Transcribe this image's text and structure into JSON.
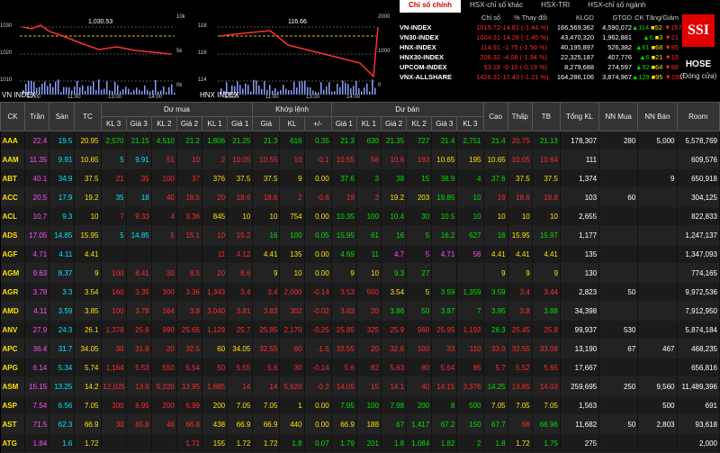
{
  "chart1": {
    "title": "VN INDEX",
    "value": "1,030.53",
    "y_left": [
      "1030",
      "1020",
      "1010"
    ],
    "y_right": [
      "10k",
      "5k",
      "0k"
    ],
    "x": [
      "10:00",
      "11:00",
      "13:00",
      "14:00"
    ]
  },
  "chart2": {
    "title": "HNX INDEX",
    "value": "116.66",
    "y_left": [
      "118",
      "116",
      "114"
    ],
    "y_right": [
      "2000",
      "1000",
      "0"
    ],
    "x": [
      "10:00",
      "11:00",
      "13:00",
      "14:00"
    ]
  },
  "tabs": [
    "Chỉ số chính",
    "HSX-chỉ số khác",
    "HSX-TRI",
    "HSX-chỉ số ngành"
  ],
  "index_headers": [
    "",
    "Chỉ số",
    "% Thay đổi",
    "KLGD",
    "GTGD",
    "CK Tăng/Giảm"
  ],
  "indexes": [
    {
      "name": "VN-INDEX",
      "value": "1015.72",
      "change": "-14.81 (-1.44 %)",
      "klgd": "166,569,362",
      "gtgd": "4,590,072",
      "up": "114",
      "flat": "52",
      "down": "157"
    },
    {
      "name": "VN30-INDEX",
      "value": "1004.31",
      "change": "-14.28 (-1.40 %)",
      "klgd": "43,470,320",
      "gtgd": "1,962,881",
      "up": "6",
      "flat": "3",
      "down": "21"
    },
    {
      "name": "HNX-INDEX",
      "value": "114.91",
      "change": "-1.75 (-1.50 %)",
      "klgd": "40,195,897",
      "gtgd": "526,382",
      "up": "61",
      "flat": "68",
      "down": "85"
    },
    {
      "name": "HNX30-INDEX",
      "value": "206.32",
      "change": "-4.08 (-1.94 %)",
      "klgd": "22,325,187",
      "gtgd": "407,776",
      "up": "6",
      "flat": "21",
      "down": "15"
    },
    {
      "name": "UPCOM-INDEX",
      "value": "53.18",
      "change": "-0.10 (-0.19 %)",
      "klgd": "8,279,688",
      "gtgd": "274,597",
      "up": "92",
      "flat": "64",
      "down": "88"
    },
    {
      "name": "VNX-ALLSHARE",
      "value": "1426.31",
      "change": "-17.43 (-1.21 %)",
      "klgd": "164,286,106",
      "gtgd": "3,874,967",
      "up": "129",
      "flat": "95",
      "down": "195"
    }
  ],
  "logo": "SSI",
  "exchange": "HOSE",
  "exchange_status": "(Đóng cửa)",
  "table": {
    "group_headers": [
      "CK",
      "Trần",
      "Sàn",
      "TC",
      "Dư mua",
      "Khớp lệnh",
      "Dư bán",
      "Cao",
      "Thấp",
      "TB",
      "Tổng KL",
      "NN Mua",
      "NN Bán",
      "Room"
    ],
    "sub_headers": [
      "KL 3",
      "Giá 3",
      "KL 2",
      "Giá 2",
      "KL 1",
      "Giá 1",
      "Giá",
      "KL",
      "+/-",
      "Giá 1",
      "KL 1",
      "Giá 2",
      "KL 2",
      "Giá 3",
      "KL 3"
    ],
    "rows": [
      [
        "AAA",
        "22.4",
        "19.5",
        "20.95",
        "2,570",
        "21.15",
        "4,510",
        "21.2",
        "1,806",
        "21.25",
        "21.3",
        "616",
        "0.35",
        "21.3",
        "630",
        "21.35",
        "727",
        "21.4",
        "2,751",
        "21.4",
        "20.75",
        "21.13",
        "178,307",
        "280",
        "5,000",
        "5,578,769"
      ],
      [
        "AAM",
        "11.35",
        "9.91",
        "10.65",
        "5",
        "9.91",
        "51",
        "10",
        "2",
        "10.05",
        "10.55",
        "10",
        "-0.1",
        "10.55",
        "56",
        "10.6",
        "193",
        "10.65",
        "195",
        "10.65",
        "10.05",
        "10.64",
        "111",
        "",
        "",
        "609,576"
      ],
      [
        "ABT",
        "40.1",
        "34.9",
        "37.5",
        "21",
        "35",
        "100",
        "37",
        "376",
        "37.5",
        "37.5",
        "9",
        "0.00",
        "37.6",
        "3",
        "38",
        "15",
        "38.9",
        "4",
        "37.6",
        "37.5",
        "37.5",
        "1,374",
        "",
        "9",
        "650,918"
      ],
      [
        "ACC",
        "20.5",
        "17.9",
        "19.2",
        "35",
        "18",
        "40",
        "18.5",
        "20",
        "18.6",
        "18.6",
        "2",
        "-0.6",
        "19",
        "3",
        "19.2",
        "203",
        "19.85",
        "10",
        "19",
        "18.6",
        "18.8",
        "103",
        "60",
        "",
        "304,125"
      ],
      [
        "ACL",
        "10.7",
        "9.3",
        "10",
        "7",
        "9.33",
        "4",
        "9.36",
        "845",
        "10",
        "10",
        "754",
        "0.00",
        "10.35",
        "100",
        "10.4",
        "30",
        "10.5",
        "10",
        "10",
        "10",
        "10",
        "2,655",
        "",
        "",
        "822,833"
      ],
      [
        "ADS",
        "17.05",
        "14.85",
        "15.95",
        "5",
        "14.85",
        "5",
        "15.1",
        "10",
        "15.2",
        "16",
        "100",
        "0.05",
        "15.95",
        "61",
        "16",
        "5",
        "16.2",
        "627",
        "16",
        "15.95",
        "15.97",
        "1,177",
        "",
        "",
        "1,247,137"
      ],
      [
        "AGF",
        "4.71",
        "4.11",
        "4.41",
        "",
        "",
        "",
        "",
        "11",
        "4.12",
        "4.41",
        "135",
        "0.00",
        "4.69",
        "11",
        "4.7",
        "5",
        "4.71",
        "56",
        "4.41",
        "4.41",
        "4.41",
        "135",
        "",
        "",
        "1,347,093"
      ],
      [
        "AGM",
        "9.63",
        "8.37",
        "9",
        "100",
        "8.41",
        "30",
        "8.5",
        "20",
        "8.6",
        "9",
        "10",
        "0.00",
        "9",
        "10",
        "9.3",
        "27",
        "",
        "",
        "9",
        "9",
        "9",
        "130",
        "",
        "",
        "774,165"
      ],
      [
        "AGR",
        "3.78",
        "3.3",
        "3.54",
        "160",
        "3.35",
        "300",
        "3.36",
        "1,343",
        "3.4",
        "3.4",
        "2,000",
        "-0.14",
        "3.53",
        "500",
        "3.54",
        "5",
        "3.59",
        "1,359",
        "3.59",
        "3.4",
        "3.44",
        "2,823",
        "50",
        "",
        "9,972,536"
      ],
      [
        "AMD",
        "4.11",
        "3.59",
        "3.85",
        "100",
        "3.78",
        "164",
        "3.8",
        "3,040",
        "3.81",
        "3.83",
        "302",
        "-0.02",
        "3.83",
        "20",
        "3.86",
        "50",
        "3.87",
        "7",
        "3.95",
        "3.8",
        "3.88",
        "34,398",
        "",
        "",
        "7,912,950"
      ],
      [
        "ANV",
        "27.9",
        "24.3",
        "26.1",
        "1,378",
        "25.6",
        "990",
        "25.65",
        "1,129",
        "25.7",
        "25.85",
        "2,170",
        "-0.25",
        "25.85",
        "325",
        "25.9",
        "960",
        "25.95",
        "1,192",
        "26.3",
        "25.45",
        "25.8",
        "99,937",
        "530",
        "",
        "5,874,184"
      ],
      [
        "APC",
        "36.4",
        "31.7",
        "34.05",
        "30",
        "31.9",
        "20",
        "32.5",
        "60",
        "34.05",
        "32.55",
        "60",
        "-1.5",
        "32.55",
        "20",
        "32.6",
        "100",
        "33",
        "110",
        "33.9",
        "32.55",
        "33.09",
        "13,190",
        "67",
        "467",
        "468,235"
      ],
      [
        "APG",
        "6.14",
        "5.34",
        "5.74",
        "1,164",
        "5.53",
        "550",
        "5.54",
        "50",
        "5.55",
        "5.6",
        "30",
        "-0.14",
        "5.6",
        "82",
        "5.63",
        "80",
        "5.64",
        "85",
        "5.7",
        "5.52",
        "5.65",
        "17,667",
        "",
        "",
        "656,816"
      ],
      [
        "ASM",
        "15.15",
        "13.25",
        "14.2",
        "12,025",
        "13.9",
        "5,220",
        "13.95",
        "1,885",
        "14",
        "14",
        "5,620",
        "-0.2",
        "14.05",
        "15",
        "14.1",
        "40",
        "14.15",
        "3,376",
        "14.25",
        "13.85",
        "14.03",
        "259,695",
        "250",
        "9,560",
        "11,489,396"
      ],
      [
        "ASP",
        "7.54",
        "6.56",
        "7.05",
        "300",
        "6.95",
        "200",
        "6.99",
        "200",
        "7.05",
        "7.05",
        "1",
        "0.00",
        "7.95",
        "100",
        "7.98",
        "200",
        "8",
        "500",
        "7.05",
        "7.05",
        "7.05",
        "1,563",
        "",
        "500",
        "691"
      ],
      [
        "AST",
        "71.5",
        "62.3",
        "66.9",
        "30",
        "65.8",
        "46",
        "66.8",
        "438",
        "66.9",
        "66.9",
        "440",
        "0.00",
        "66.9",
        "188",
        "67",
        "1,417",
        "67.2",
        "150",
        "67.7",
        "66",
        "66.96",
        "11,682",
        "50",
        "2,803",
        "93,618"
      ],
      [
        "ATG",
        "1.84",
        "1.6",
        "1.72",
        "",
        "",
        "",
        "1.71",
        "155",
        "1.72",
        "1.72",
        "1.8",
        "0.07",
        "1.79",
        "201",
        "1.8",
        "1,084",
        "1.82",
        "2",
        "1.8",
        "1.72",
        "1.75",
        "275",
        "",
        "",
        "2,000"
      ]
    ],
    "row_colors": [
      [
        "yellow",
        "magenta",
        "cyan",
        "yellow",
        "green",
        "green",
        "green",
        "green",
        "green",
        "green",
        "green",
        "green",
        "green",
        "green",
        "green",
        "green",
        "green",
        "green",
        "green",
        "green",
        "red",
        "green",
        "white",
        "white",
        "white",
        "white"
      ],
      [
        "yellow",
        "magenta",
        "cyan",
        "yellow",
        "cyan",
        "cyan",
        "red",
        "red",
        "red",
        "red",
        "red",
        "red",
        "red",
        "red",
        "red",
        "red",
        "red",
        "yellow",
        "yellow",
        "yellow",
        "red",
        "red",
        "white",
        "white",
        "white",
        "white"
      ],
      [
        "yellow",
        "magenta",
        "cyan",
        "yellow",
        "red",
        "red",
        "red",
        "red",
        "yellow",
        "yellow",
        "yellow",
        "yellow",
        "yellow",
        "green",
        "green",
        "green",
        "green",
        "green",
        "green",
        "green",
        "yellow",
        "yellow",
        "white",
        "white",
        "white",
        "white"
      ],
      [
        "yellow",
        "magenta",
        "cyan",
        "yellow",
        "cyan",
        "cyan",
        "red",
        "red",
        "red",
        "red",
        "red",
        "red",
        "red",
        "red",
        "red",
        "yellow",
        "yellow",
        "green",
        "green",
        "red",
        "red",
        "red",
        "white",
        "white",
        "white",
        "white"
      ],
      [
        "yellow",
        "magenta",
        "cyan",
        "yellow",
        "red",
        "red",
        "red",
        "red",
        "yellow",
        "yellow",
        "yellow",
        "yellow",
        "yellow",
        "green",
        "green",
        "green",
        "green",
        "green",
        "green",
        "yellow",
        "yellow",
        "yellow",
        "white",
        "white",
        "white",
        "white"
      ],
      [
        "yellow",
        "magenta",
        "cyan",
        "yellow",
        "cyan",
        "cyan",
        "red",
        "red",
        "red",
        "red",
        "green",
        "green",
        "green",
        "green",
        "green",
        "green",
        "green",
        "green",
        "green",
        "green",
        "yellow",
        "green",
        "white",
        "white",
        "white",
        "white"
      ],
      [
        "yellow",
        "magenta",
        "cyan",
        "yellow",
        "white",
        "white",
        "white",
        "white",
        "red",
        "red",
        "yellow",
        "yellow",
        "yellow",
        "green",
        "green",
        "magenta",
        "magenta",
        "magenta",
        "magenta",
        "yellow",
        "yellow",
        "yellow",
        "white",
        "white",
        "white",
        "white"
      ],
      [
        "yellow",
        "magenta",
        "cyan",
        "yellow",
        "red",
        "red",
        "red",
        "red",
        "red",
        "red",
        "yellow",
        "yellow",
        "yellow",
        "yellow",
        "yellow",
        "green",
        "green",
        "white",
        "white",
        "yellow",
        "yellow",
        "yellow",
        "white",
        "white",
        "white",
        "white"
      ],
      [
        "yellow",
        "magenta",
        "cyan",
        "yellow",
        "red",
        "red",
        "red",
        "red",
        "red",
        "red",
        "red",
        "red",
        "red",
        "red",
        "red",
        "yellow",
        "yellow",
        "green",
        "green",
        "green",
        "red",
        "red",
        "white",
        "white",
        "white",
        "white"
      ],
      [
        "yellow",
        "magenta",
        "cyan",
        "yellow",
        "red",
        "red",
        "red",
        "red",
        "red",
        "red",
        "red",
        "red",
        "red",
        "red",
        "red",
        "green",
        "green",
        "green",
        "green",
        "green",
        "red",
        "green",
        "white",
        "white",
        "white",
        "white"
      ],
      [
        "yellow",
        "magenta",
        "cyan",
        "yellow",
        "red",
        "red",
        "red",
        "red",
        "red",
        "red",
        "red",
        "red",
        "red",
        "red",
        "red",
        "red",
        "red",
        "red",
        "red",
        "green",
        "red",
        "red",
        "white",
        "white",
        "white",
        "white"
      ],
      [
        "yellow",
        "magenta",
        "cyan",
        "yellow",
        "red",
        "red",
        "red",
        "red",
        "yellow",
        "yellow",
        "red",
        "red",
        "red",
        "red",
        "red",
        "red",
        "red",
        "red",
        "red",
        "red",
        "red",
        "red",
        "white",
        "white",
        "white",
        "white"
      ],
      [
        "yellow",
        "magenta",
        "cyan",
        "yellow",
        "red",
        "red",
        "red",
        "red",
        "red",
        "red",
        "red",
        "red",
        "red",
        "red",
        "red",
        "red",
        "red",
        "red",
        "red",
        "red",
        "red",
        "red",
        "white",
        "white",
        "white",
        "white"
      ],
      [
        "yellow",
        "magenta",
        "cyan",
        "yellow",
        "red",
        "red",
        "red",
        "red",
        "red",
        "red",
        "red",
        "red",
        "red",
        "red",
        "red",
        "red",
        "red",
        "red",
        "red",
        "green",
        "red",
        "red",
        "white",
        "white",
        "white",
        "white"
      ],
      [
        "yellow",
        "magenta",
        "cyan",
        "yellow",
        "red",
        "red",
        "red",
        "red",
        "yellow",
        "yellow",
        "yellow",
        "yellow",
        "yellow",
        "green",
        "green",
        "green",
        "green",
        "green",
        "green",
        "yellow",
        "yellow",
        "yellow",
        "white",
        "white",
        "white",
        "white"
      ],
      [
        "yellow",
        "magenta",
        "cyan",
        "yellow",
        "red",
        "red",
        "red",
        "red",
        "yellow",
        "yellow",
        "yellow",
        "yellow",
        "yellow",
        "yellow",
        "yellow",
        "green",
        "green",
        "green",
        "green",
        "green",
        "red",
        "green",
        "white",
        "white",
        "white",
        "white"
      ],
      [
        "yellow",
        "magenta",
        "cyan",
        "yellow",
        "white",
        "white",
        "white",
        "red",
        "yellow",
        "yellow",
        "yellow",
        "green",
        "green",
        "green",
        "green",
        "green",
        "green",
        "green",
        "green",
        "green",
        "yellow",
        "green",
        "white",
        "white",
        "white",
        "white"
      ]
    ]
  }
}
